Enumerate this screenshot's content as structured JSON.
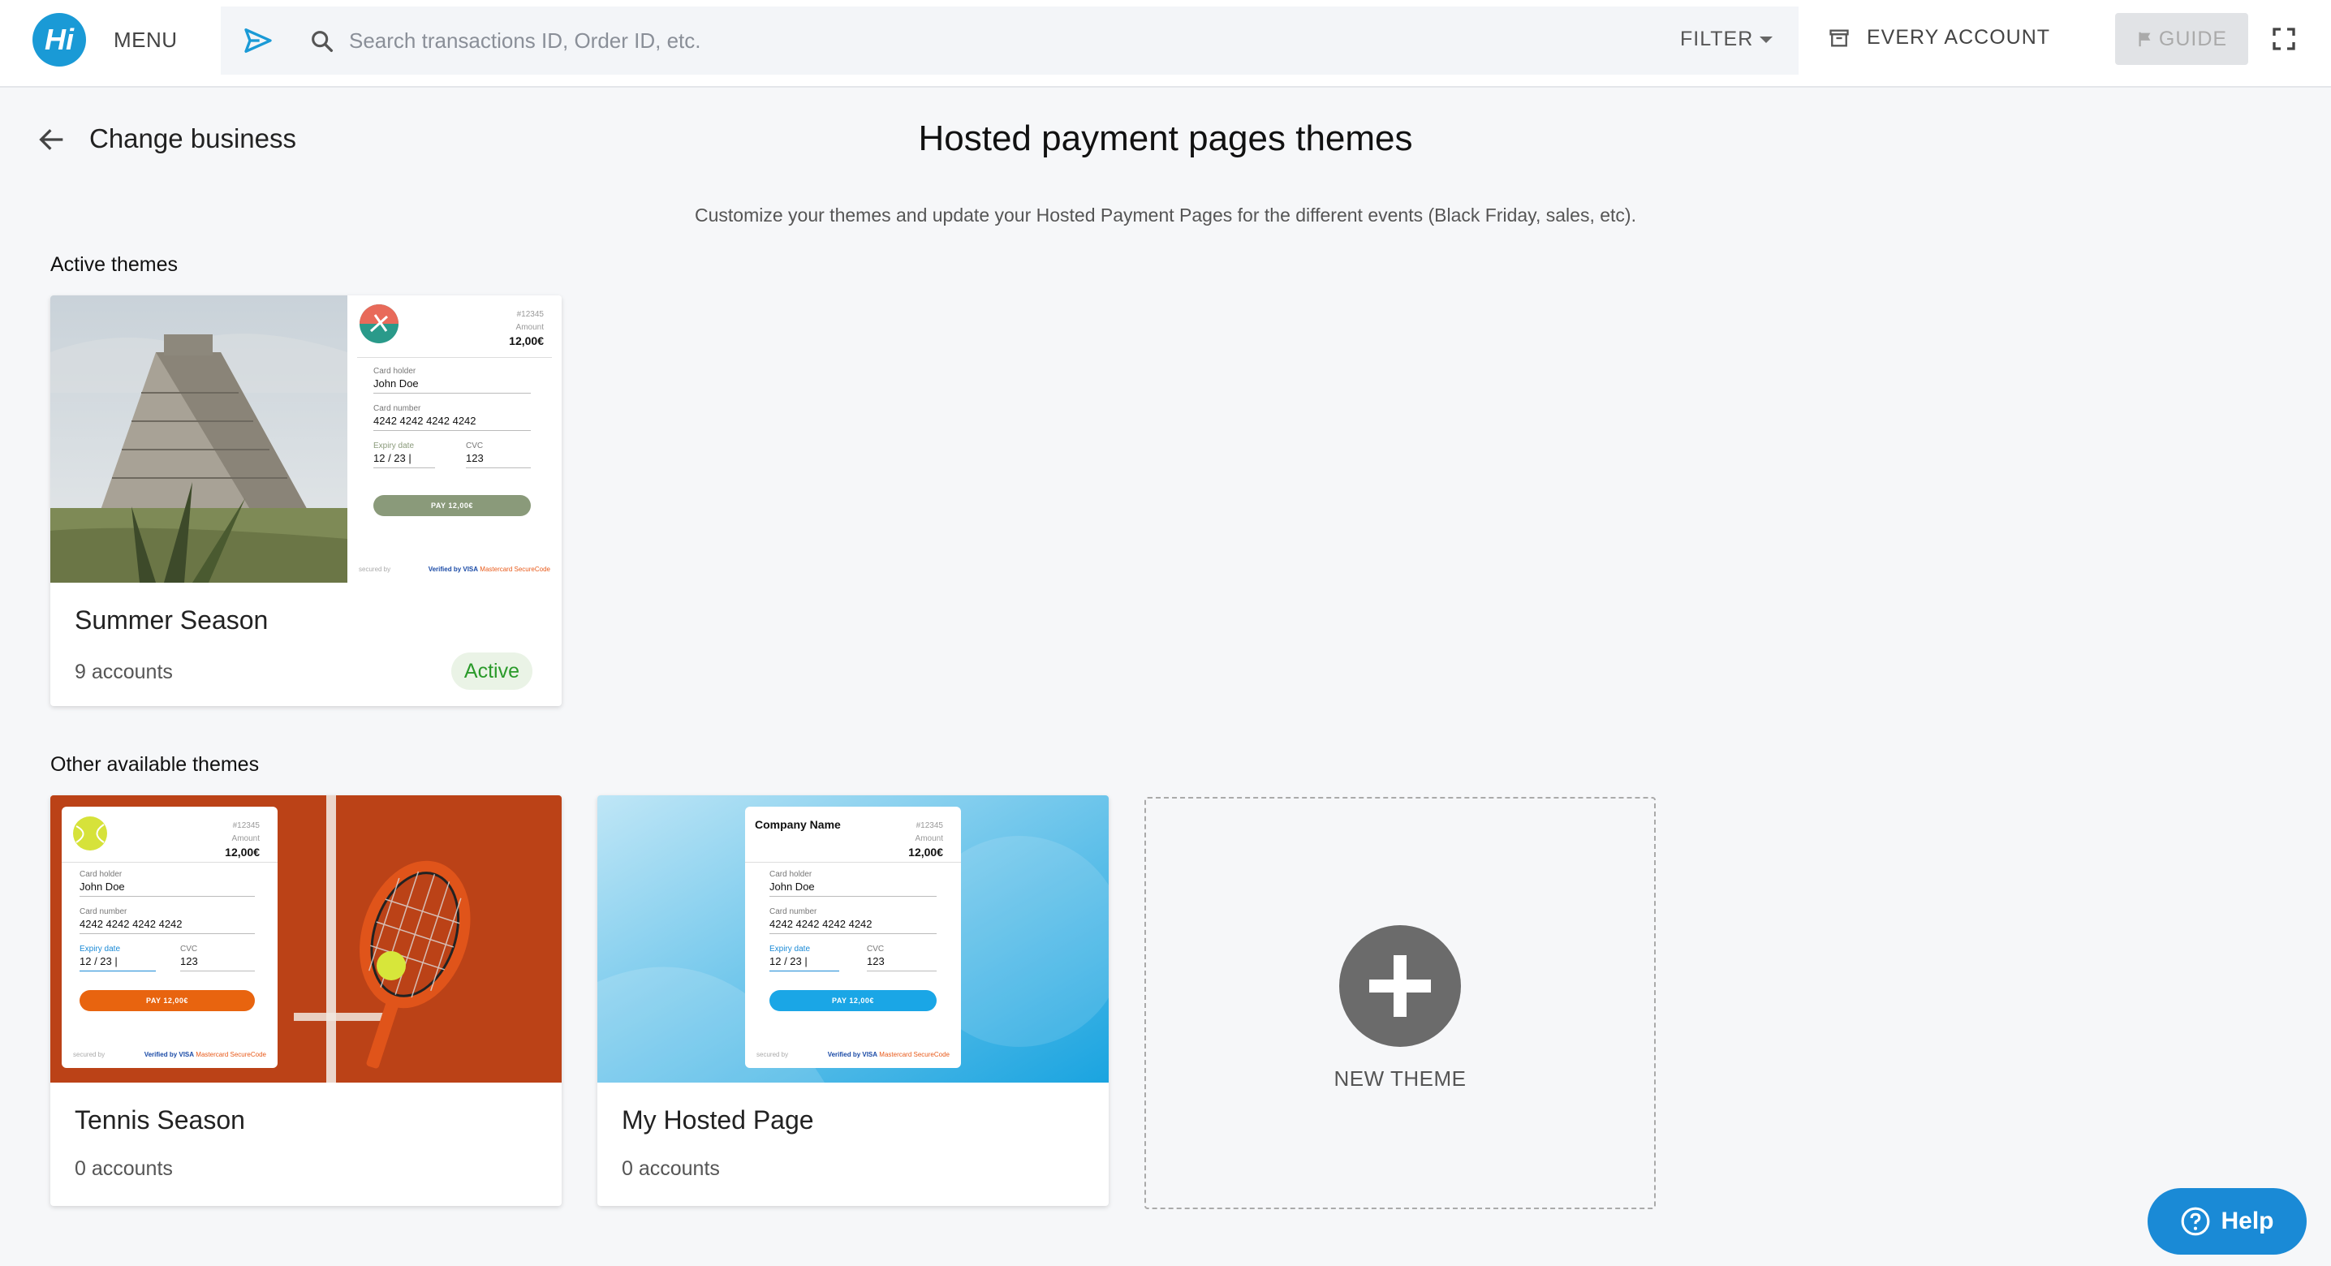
{
  "topbar": {
    "logo_text": "Hi",
    "menu_label": "MENU",
    "search_placeholder": "Search transactions ID, Order ID, etc.",
    "filter_label": "FILTER",
    "account_label": "EVERY ACCOUNT",
    "guide_label": "GUIDE"
  },
  "header": {
    "back_label": "Change business",
    "title": "Hosted payment pages themes",
    "subtitle": "Customize your themes and update your Hosted Payment Pages for the different events (Black Friday, sales, etc)."
  },
  "sections": {
    "active_label": "Active themes",
    "other_label": "Other available themes"
  },
  "preview_form": {
    "order_ref": "#12345",
    "amount_label": "Amount",
    "amount": "12,00€",
    "company_name": "Company Name",
    "holder_label": "Card holder",
    "holder_value": "John Doe",
    "number_label": "Card number",
    "number_value": "4242 4242 4242 4242",
    "expiry_label": "Expiry date",
    "expiry_value": "12 / 23 |",
    "cvc_label": "CVC",
    "cvc_value": "123",
    "pay_label": "PAY 12,00€",
    "secured_label": "secured by",
    "brand_visa": "Verified by VISA",
    "brand_mc": "Mastercard SecureCode"
  },
  "active_themes": [
    {
      "title": "Summer Season",
      "accounts": "9 accounts",
      "status": "Active"
    }
  ],
  "other_themes": [
    {
      "title": "Tennis Season",
      "accounts": "0 accounts"
    },
    {
      "title": "My Hosted Page",
      "accounts": "0 accounts"
    }
  ],
  "new_theme_label": "NEW THEME",
  "help_label": "Help",
  "colors": {
    "brand": "#1a9ad6",
    "summer_pay": "#8a9a7a",
    "tennis_pay": "#e8640f",
    "hosted_pay": "#1aa6e6",
    "active_text": "#2a9a2a"
  }
}
